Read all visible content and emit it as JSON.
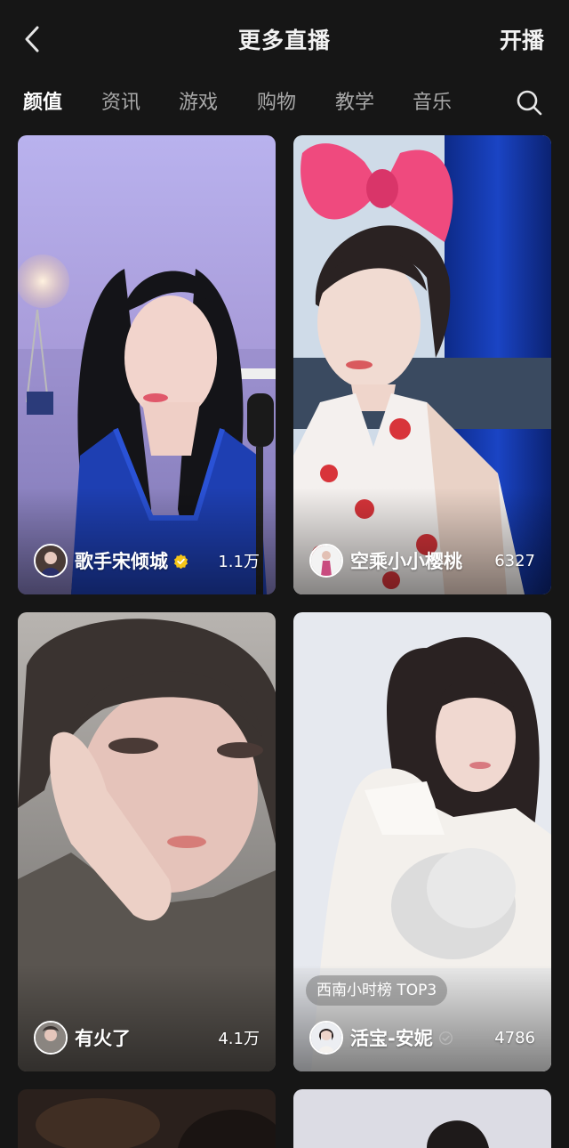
{
  "header": {
    "title": "更多直播",
    "action_label": "开播"
  },
  "tabs": [
    {
      "label": "颜值",
      "active": true
    },
    {
      "label": "资讯",
      "active": false
    },
    {
      "label": "游戏",
      "active": false
    },
    {
      "label": "购物",
      "active": false
    },
    {
      "label": "教学",
      "active": false
    },
    {
      "label": "音乐",
      "active": false
    }
  ],
  "icons": {
    "back": "chevron-left-icon",
    "search": "search-icon",
    "verified": "verified-badge-icon"
  },
  "colors": {
    "background": "#161616",
    "verified_gold": "#f5c518",
    "verified_gray": "#b8b8b8"
  },
  "cards": [
    {
      "streamer": "歌手宋倾城",
      "viewers": "1.1万",
      "verified": "gold"
    },
    {
      "streamer": "空乘小小樱桃",
      "viewers": "6327"
    },
    {
      "streamer": "有火了",
      "viewers": "4.1万"
    },
    {
      "streamer": "活宝-安妮",
      "viewers": "4786",
      "verified": "gray",
      "badge": "西南小时榜 TOP3"
    }
  ]
}
